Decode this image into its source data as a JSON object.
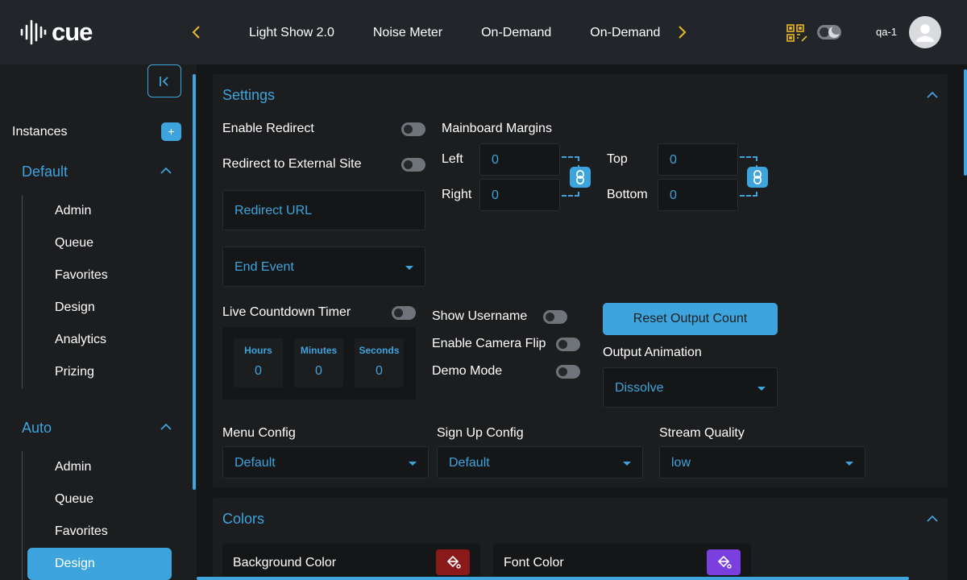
{
  "brand": {
    "name": "cue"
  },
  "colors": {
    "accent": "#3ea4dd",
    "nav_arrow": "#e9b728",
    "background_swatch": "#8a1a1a",
    "font_swatch": "#7b3fe0"
  },
  "header": {
    "tabs": [
      "Light Show 2.0",
      "Noise Meter",
      "On-Demand",
      "On-Demand"
    ],
    "username": "qa-1"
  },
  "sidebar": {
    "instances_label": "Instances",
    "add_label": "+",
    "groups": [
      {
        "title": "Default",
        "items": [
          "Admin",
          "Queue",
          "Favorites",
          "Design",
          "Analytics",
          "Prizing"
        ]
      },
      {
        "title": "Auto",
        "items": [
          "Admin",
          "Queue",
          "Favorites",
          "Design"
        ],
        "active": "Design"
      }
    ]
  },
  "settings": {
    "title": "Settings",
    "enable_redirect": "Enable Redirect",
    "redirect_external": "Redirect to External Site",
    "redirect_url_placeholder": "Redirect URL",
    "end_event": "End Event",
    "mainboard_margins": "Mainboard Margins",
    "margins": {
      "left_label": "Left",
      "left_value": "0",
      "right_label": "Right",
      "right_value": "0",
      "top_label": "Top",
      "top_value": "0",
      "bottom_label": "Bottom",
      "bottom_value": "0"
    },
    "live_countdown": "Live Countdown Timer",
    "timer": {
      "hours_label": "Hours",
      "hours_value": "0",
      "minutes_label": "Minutes",
      "minutes_value": "0",
      "seconds_label": "Seconds",
      "seconds_value": "0"
    },
    "show_username": "Show Username",
    "enable_camera_flip": "Enable Camera Flip",
    "demo_mode": "Demo Mode",
    "reset_output_count": "Reset Output Count",
    "output_animation_label": "Output Animation",
    "output_animation_value": "Dissolve",
    "menu_config_label": "Menu Config",
    "menu_config_value": "Default",
    "signup_config_label": "Sign Up Config",
    "signup_config_value": "Default",
    "stream_quality_label": "Stream Quality",
    "stream_quality_value": "low"
  },
  "colors_section": {
    "title": "Colors",
    "background_color": "Background Color",
    "font_color": "Font Color"
  }
}
